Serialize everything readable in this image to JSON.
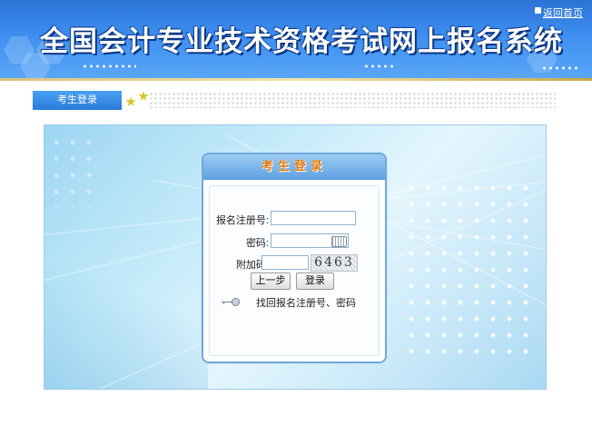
{
  "header": {
    "title": "全国会计专业技术资格考试网上报名系统",
    "home_link": "返回首页"
  },
  "nav": {
    "tab_label": "考生登录",
    "icons": [
      "star-icon",
      "star-icon"
    ]
  },
  "login": {
    "box_title": "考生登录",
    "reg_label": "报名注册号:",
    "reg_value": "",
    "password_label": "密码:",
    "password_value": "",
    "captcha_label": "附加码:",
    "captcha_value": "",
    "captcha_image_text": "6463",
    "back_button": "上一步",
    "login_button": "登录",
    "recover_link": "找回报名注册号、密码"
  },
  "colors": {
    "banner_blue": "#3d8ef0",
    "nav_tab_blue": "#2a7ad8",
    "box_title_orange": "#e07a10",
    "panel_light_blue": "#c8ecfa"
  }
}
